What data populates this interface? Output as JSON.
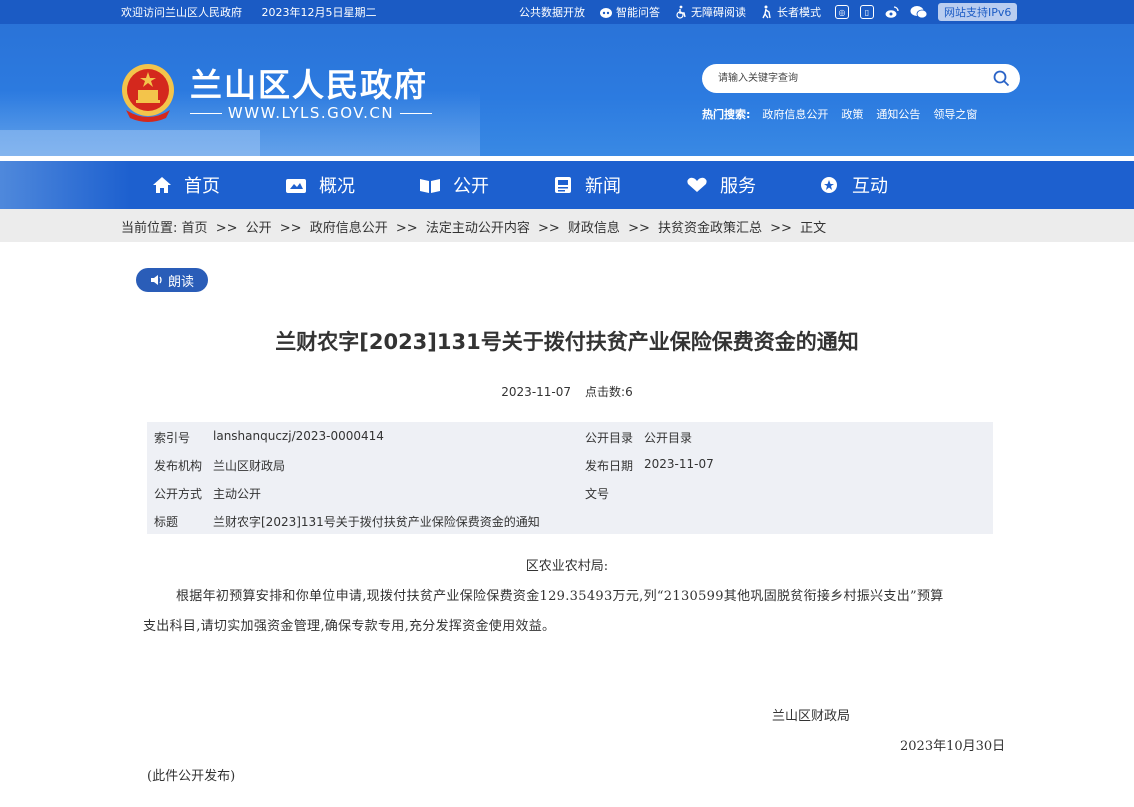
{
  "topbar": {
    "welcome": "欢迎访问兰山区人民政府",
    "date": "2023年12月5日星期二",
    "links": {
      "public_data": "公共数据开放",
      "smart_qa": "智能问答",
      "accessible": "无障碍阅读",
      "elderly": "长者模式",
      "ipv6": "网站支持IPv6"
    },
    "icons": [
      "public-data-icon",
      "robot-icon",
      "wheelchair-icon",
      "elderly-icon",
      "mini-program-icon",
      "mobile-icon",
      "weibo-icon",
      "wechat-icon"
    ]
  },
  "header": {
    "site_title": "兰山区人民政府",
    "site_url": "WWW.LYLS.GOV.CN",
    "search_placeholder": "请输入关键字查询",
    "hot_label": "热门搜索:",
    "hot_terms": [
      "政府信息公开",
      "政策",
      "通知公告",
      "领导之窗"
    ]
  },
  "nav": {
    "items": [
      {
        "label": "首页",
        "icon": "home-icon"
      },
      {
        "label": "概况",
        "icon": "overview-icon"
      },
      {
        "label": "公开",
        "icon": "open-book-icon"
      },
      {
        "label": "新闻",
        "icon": "news-icon"
      },
      {
        "label": "服务",
        "icon": "service-icon"
      },
      {
        "label": "互动",
        "icon": "chat-icon"
      }
    ]
  },
  "breadcrumb": {
    "prefix": "当前位置:",
    "sep": ">>",
    "items": [
      "首页",
      "公开",
      "政府信息公开",
      "法定主动公开内容",
      "财政信息",
      "扶贫资金政策汇总",
      "正文"
    ]
  },
  "article": {
    "read_label": "朗读",
    "title": "兰财农字[2023]131号关于拨付扶贫产业保险保费资金的通知",
    "date": "2023-11-07",
    "clicks": "点击数:6",
    "info": {
      "index_label": "索引号",
      "index_value": "lanshanquczj/2023-0000414",
      "catalog_label": "公开目录",
      "catalog_value": "公开目录",
      "issuer_label": "发布机构",
      "issuer_value": "兰山区财政局",
      "pubdate_label": "发布日期",
      "pubdate_value": "2023-11-07",
      "method_label": "公开方式",
      "method_value": "主动公开",
      "docno_label": "文号",
      "docno_value": "",
      "title_label": "标题",
      "title_value": "兰财农字[2023]131号关于拨付扶贫产业保险保费资金的通知"
    },
    "recipient": "区农业农村局:",
    "para1": "根据年初预算安排和你单位申请,现拨付扶贫产业保险保费资金129.35493万元,列“2130599其他巩固脱贫衔接乡村振兴支出”预算",
    "para2": "支出科目,请切实加强资金管理,确保专款专用,充分发挥资金使用效益。",
    "signature": "兰山区财政局",
    "sign_date": "2023年10月30日",
    "note": "(此件公开发布)"
  },
  "colors": {
    "brand_blue": "#1d60cf",
    "top_strip": "#1b5bc4",
    "breadcrumb_bg": "#ececec",
    "info_bg": "#eef0f5",
    "read_button": "#2a5db8"
  }
}
